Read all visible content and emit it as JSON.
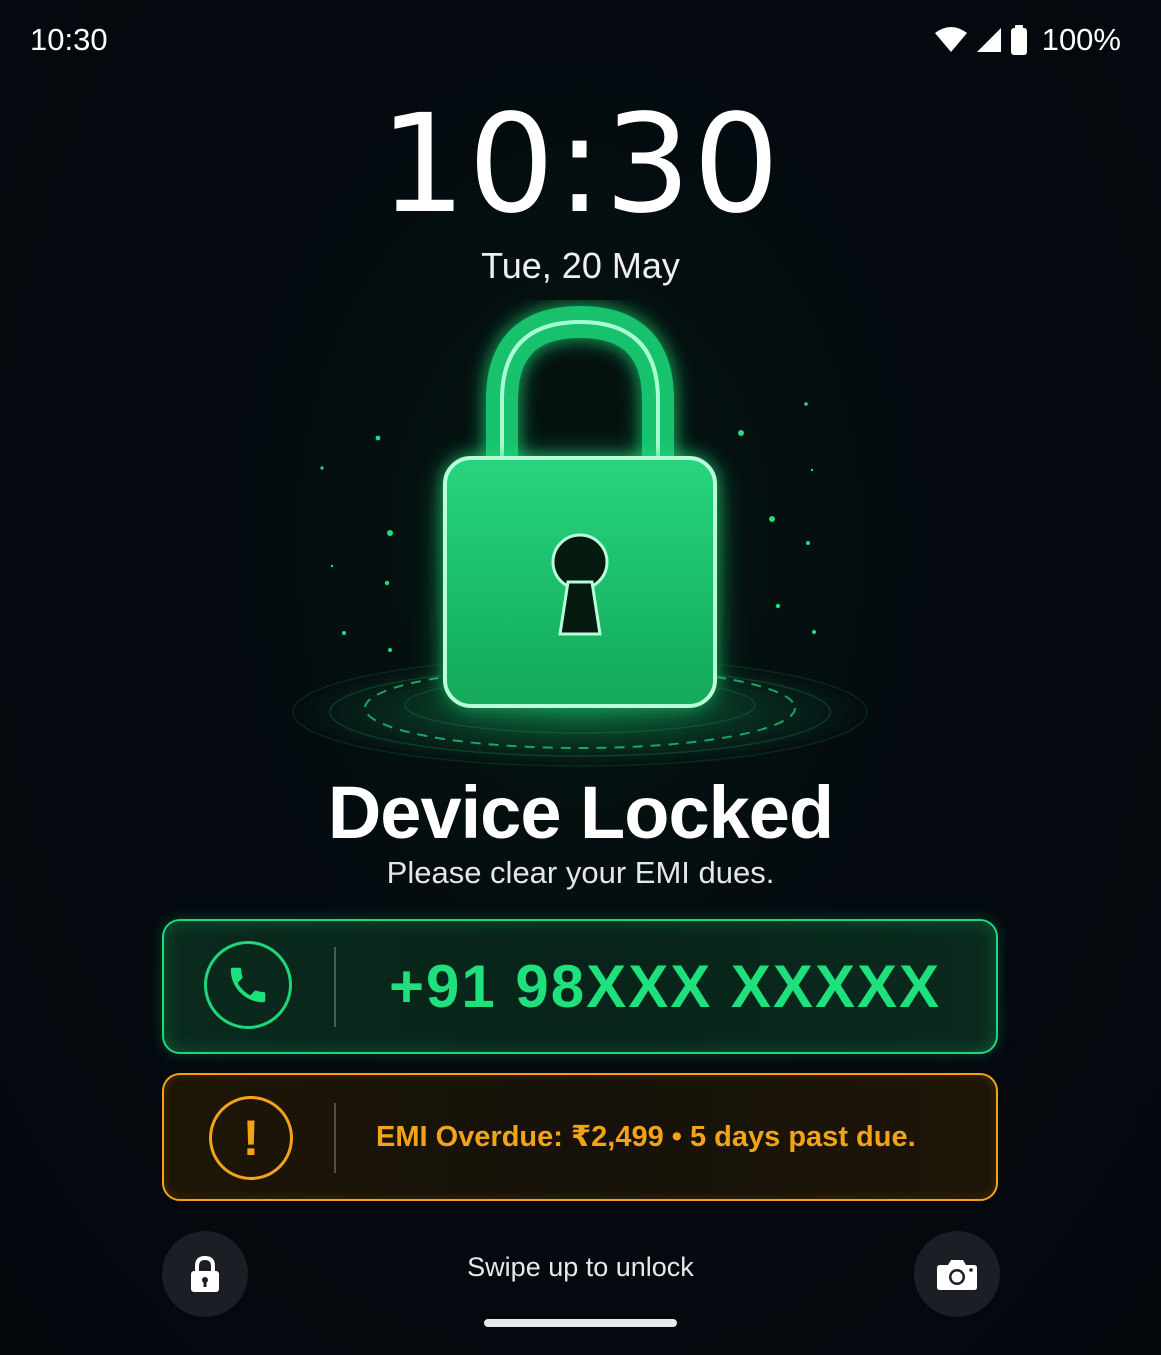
{
  "status_bar": {
    "time": "10:30",
    "battery_percent": "100%",
    "icons": [
      "wifi-icon",
      "signal-icon",
      "battery-icon"
    ]
  },
  "lockscreen": {
    "clock": "10:30",
    "date": "Tue, 20 May"
  },
  "notice": {
    "title": "Device Locked",
    "subtitle": "Please clear your EMI dues."
  },
  "contact": {
    "icon": "phone-icon",
    "phone_number": "+91 98XXX XXXXX"
  },
  "emi_alert": {
    "icon": "exclamation-icon",
    "message": "EMI Overdue: ₹2,499 • 5 days past due."
  },
  "bottom": {
    "left_icon": "lock-icon",
    "right_icon": "camera-icon",
    "swipe_hint": "Swipe up to unlock"
  },
  "colors": {
    "accent_green": "#1ee07c",
    "warning_orange": "#f2a31a",
    "background": "#040a10"
  }
}
